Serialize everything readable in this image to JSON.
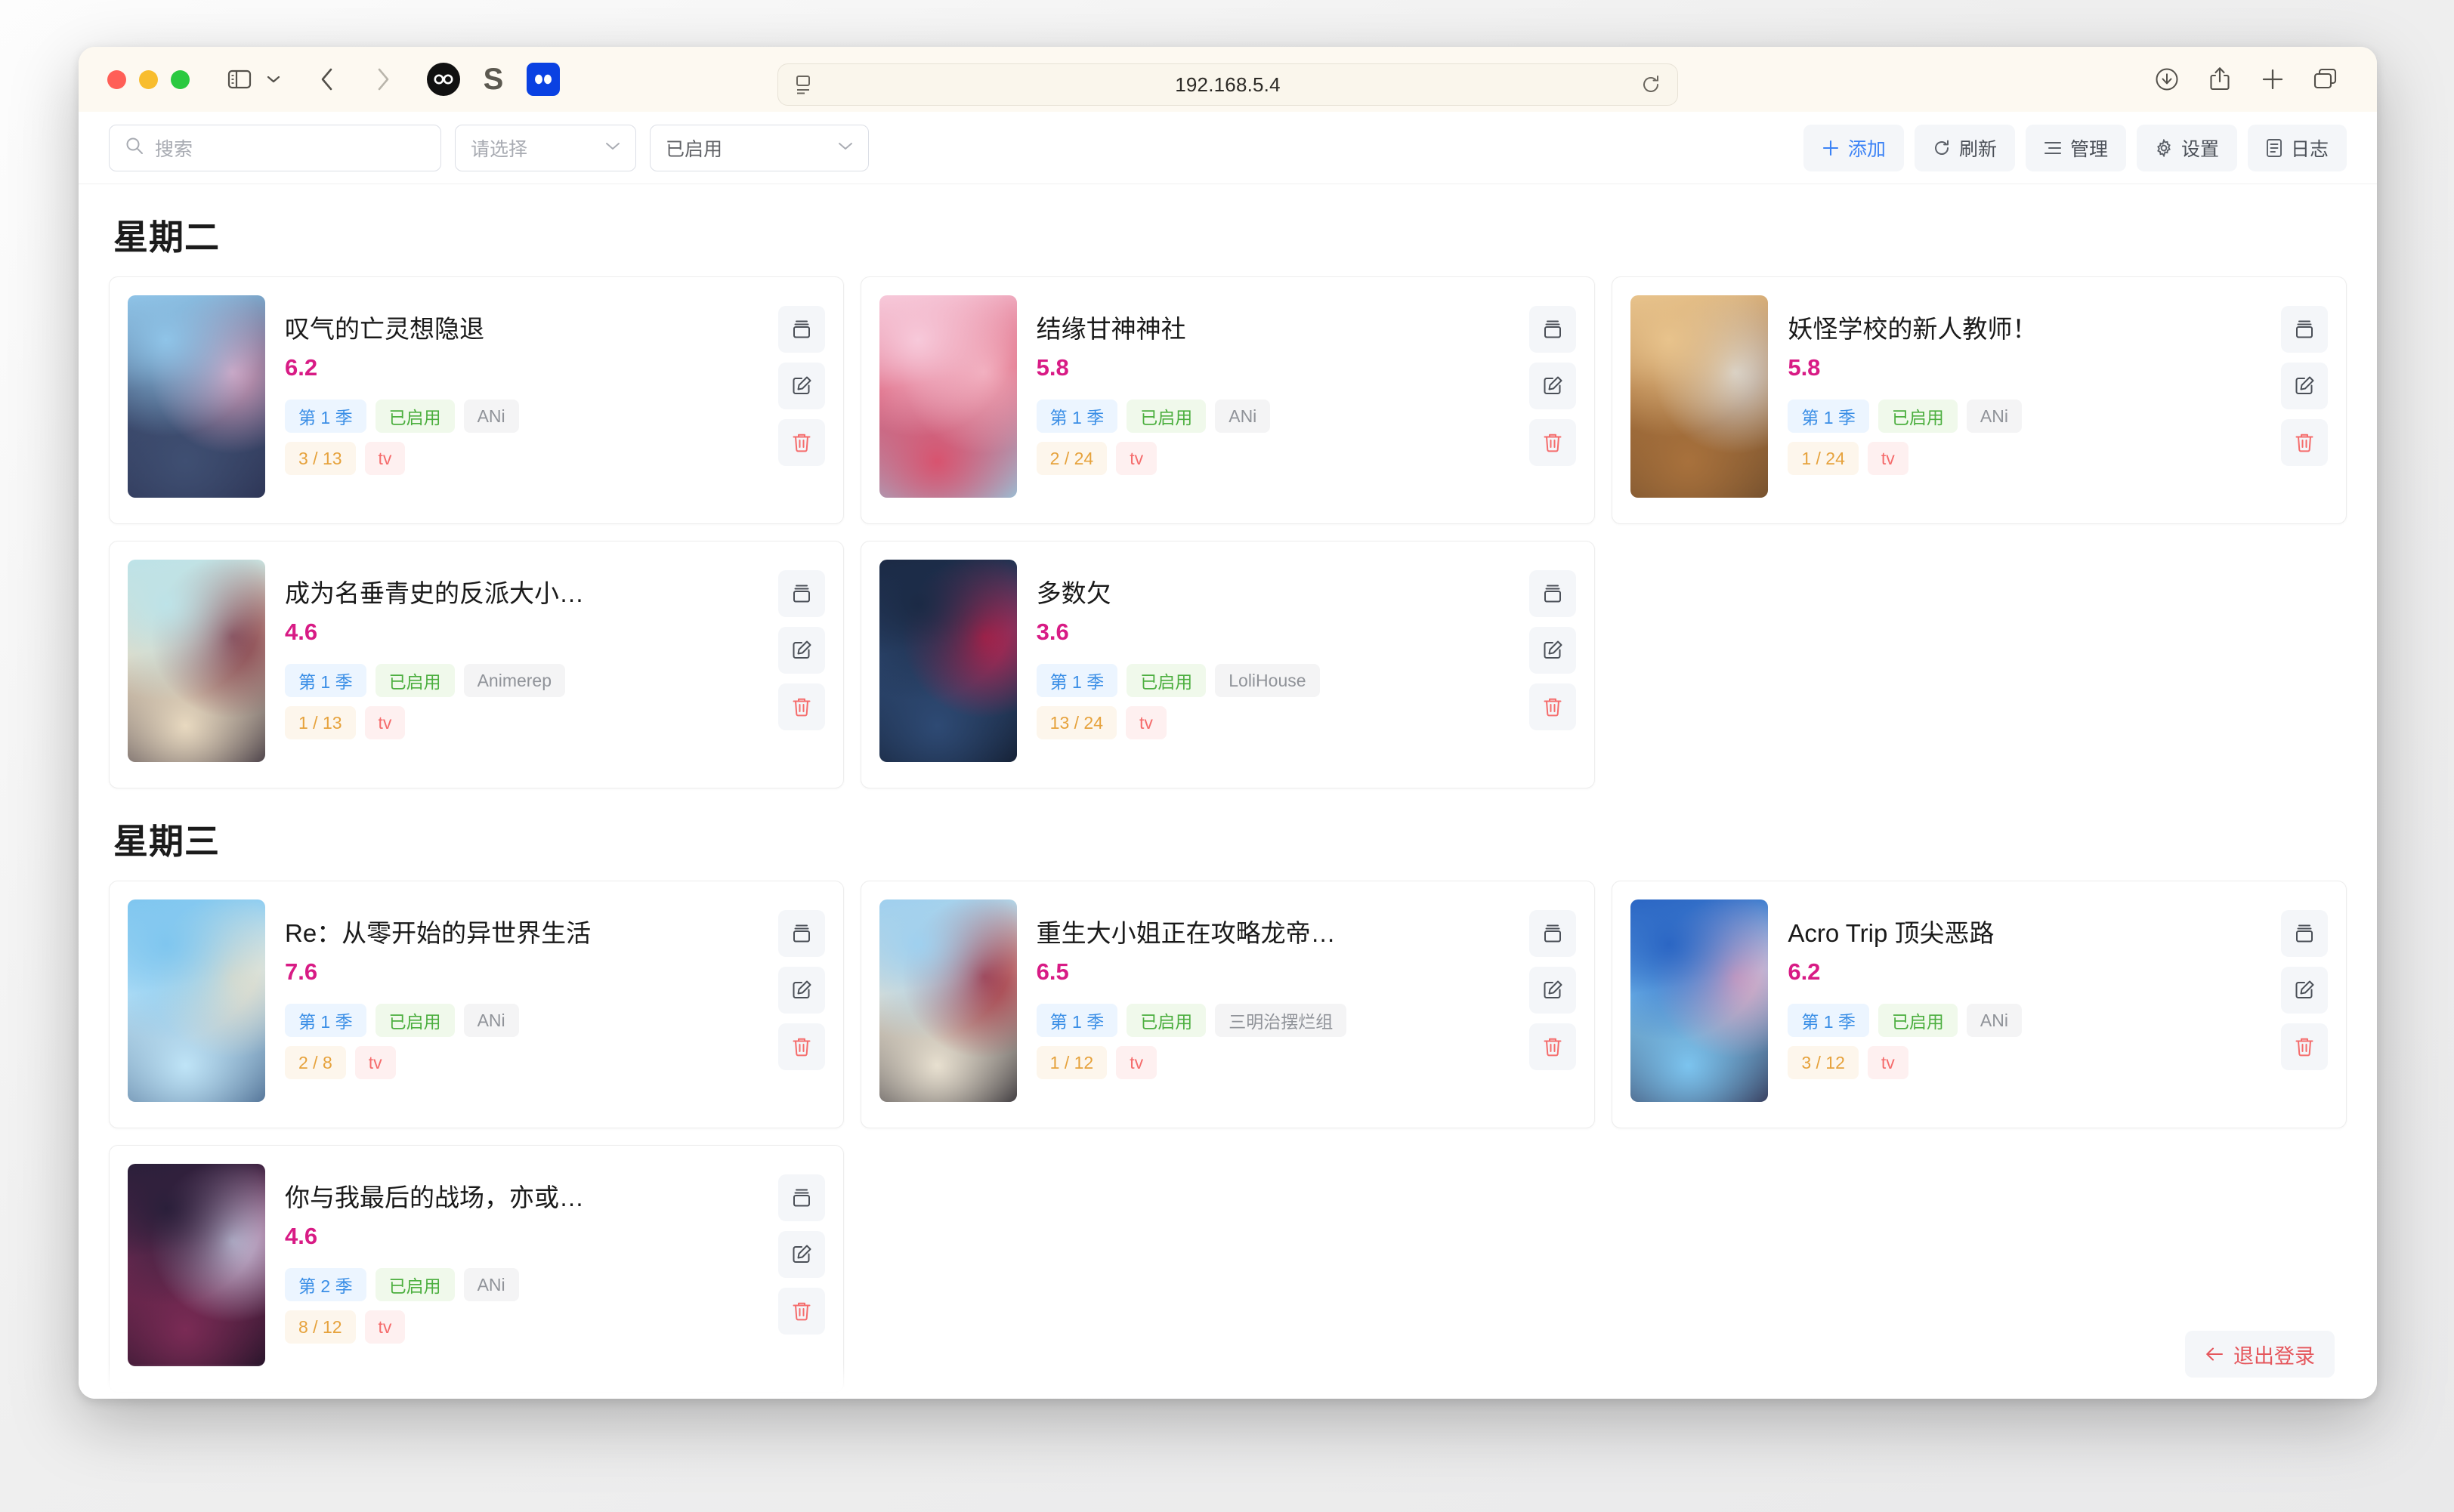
{
  "browser": {
    "url": "192.168.5.4",
    "icons": {
      "sidebar": "sidebar-icon",
      "sidebar_chevron": "chevron-down-icon",
      "back": "back-chevron-icon",
      "forward": "forward-chevron-icon",
      "favicon_1": "infinity-favicon",
      "favicon_2": "s-favicon",
      "favicon_3": "blue-favicon",
      "reader": "reader-view-icon",
      "reload": "reload-icon",
      "download": "download-icon",
      "share": "share-icon",
      "new_tab": "plus-icon",
      "tab_overview": "tab-overview-icon"
    },
    "traffic_lights": [
      "close",
      "minimize",
      "maximize"
    ]
  },
  "toolbar": {
    "search_placeholder": "搜索",
    "filter_select_value": "请选择",
    "status_select_value": "已启用",
    "buttons": [
      {
        "label": "添加",
        "icon": "plus-icon",
        "primary": true
      },
      {
        "label": "刷新",
        "icon": "refresh-icon",
        "primary": false
      },
      {
        "label": "管理",
        "icon": "list-icon",
        "primary": false
      },
      {
        "label": "设置",
        "icon": "gear-icon",
        "primary": false
      },
      {
        "label": "日志",
        "icon": "document-icon",
        "primary": false
      }
    ]
  },
  "card_actions": {
    "collect": "collect-icon",
    "edit": "edit-icon",
    "delete": "delete-icon"
  },
  "logout": {
    "label": "退出登录",
    "icon": "arrow-left-icon"
  },
  "sections": [
    {
      "day": "星期二",
      "items": [
        {
          "title": "叹气的亡灵想隐退",
          "score": "6.2",
          "season": "第 1 季",
          "status": "已启用",
          "source": "ANi",
          "progress": "3 / 13",
          "type": "tv",
          "poster_colors": [
            "#8fc4e8",
            "#3f4f72",
            "#d9a0bd",
            "#2a3050"
          ]
        },
        {
          "title": "结缘甘神神社",
          "score": "5.8",
          "season": "第 1 季",
          "status": "已启用",
          "source": "ANi",
          "progress": "2 / 24",
          "type": "tv",
          "poster_colors": [
            "#f7c9da",
            "#d8536f",
            "#f0a8b8",
            "#8ed3e8"
          ]
        },
        {
          "title": "妖怪学校的新人教师！",
          "score": "5.8",
          "season": "第 1 季",
          "status": "已启用",
          "source": "ANi",
          "progress": "1 / 24",
          "type": "tv",
          "poster_colors": [
            "#e8c38c",
            "#a8713c",
            "#d6d6d6",
            "#6b4a2b"
          ]
        },
        {
          "title": "成为名垂青史的反派大小…",
          "score": "4.6",
          "season": "第 1 季",
          "status": "已启用",
          "source": "Animerep",
          "progress": "1 / 13",
          "type": "tv",
          "poster_colors": [
            "#bde3e8",
            "#e8d9c0",
            "#7a2c3c",
            "#2b2230"
          ]
        },
        {
          "title": "多数欠",
          "score": "3.6",
          "season": "第 1 季",
          "status": "已启用",
          "source": "LoliHouse",
          "progress": "13 / 24",
          "type": "tv",
          "poster_colors": [
            "#1b2a45",
            "#2e4a74",
            "#c21f4a",
            "#101828"
          ]
        }
      ]
    },
    {
      "day": "星期三",
      "items": [
        {
          "title": "Re：从零开始的异世界生活",
          "score": "7.6",
          "season": "第 1 季",
          "status": "已启用",
          "source": "ANi",
          "progress": "2 / 8",
          "type": "tv",
          "poster_colors": [
            "#7fc6ef",
            "#bfe4f7",
            "#e8dfc8",
            "#3e5d84"
          ]
        },
        {
          "title": "重生大小姐正在攻略龙帝…",
          "score": "6.5",
          "season": "第 1 季",
          "status": "已启用",
          "source": "三明治摆烂组",
          "progress": "1 / 12",
          "type": "tv",
          "poster_colors": [
            "#9fd0ef",
            "#e8e0d0",
            "#9e2233",
            "#1d1a22"
          ]
        },
        {
          "title": "Acro Trip 顶尖恶路",
          "score": "6.2",
          "season": "第 1 季",
          "status": "已启用",
          "source": "ANi",
          "progress": "3 / 12",
          "type": "tv",
          "poster_colors": [
            "#2b66c4",
            "#7cc4ef",
            "#e8a6c0",
            "#2a2340"
          ]
        },
        {
          "title": "你与我最后的战场，亦或…",
          "score": "4.6",
          "season": "第 2 季",
          "status": "已启用",
          "source": "ANi",
          "progress": "8 / 12",
          "type": "tv",
          "poster_colors": [
            "#2a1f3a",
            "#7a2b55",
            "#d0cfe8",
            "#151021"
          ]
        }
      ]
    }
  ]
}
